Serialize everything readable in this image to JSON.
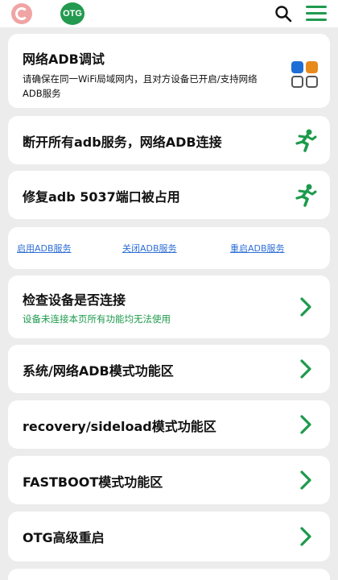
{
  "topbar": {
    "otg_label": "OTG"
  },
  "adb_card": {
    "title": "网络ADB调试",
    "desc_line1": "请确保在同一WiFi局域网内，且对方设备已开启/支持网络",
    "desc_line2": "ADB服务"
  },
  "disconnect_card": {
    "title": "断开所有adb服务，网络ADB连接"
  },
  "repair_card": {
    "title": "修复adb 5037端口被占用"
  },
  "services": {
    "start": "启用ADB服务",
    "stop": "关闭ADB服务",
    "restart": "重启ADB服务"
  },
  "check_card": {
    "title": "检查设备是否连接",
    "subtitle": "设备未连接本页所有功能均无法使用"
  },
  "menu_items": [
    {
      "label": "系统/网络ADB模式功能区"
    },
    {
      "label": "recovery/sideload模式功能区"
    },
    {
      "label": "FASTBOOT模式功能区"
    },
    {
      "label": "OTG高级重启"
    }
  ],
  "colors": {
    "accent": "#1d9a4c",
    "link": "#2f6fd6",
    "otg_badge": "#239a4f"
  }
}
